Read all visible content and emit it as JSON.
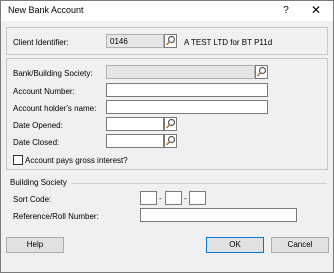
{
  "window": {
    "title": "New Bank Account",
    "help_glyph": "?",
    "close_glyph": "✕"
  },
  "client": {
    "label": "Client Identifier:",
    "value": "0146",
    "name": "A TEST LTD for BT P11d"
  },
  "fields": {
    "bank_label": "Bank/Building Society:",
    "bank_value": "",
    "account_number_label": "Account Number:",
    "account_number_value": "",
    "holder_label": "Account holder's name:",
    "holder_value": "",
    "opened_label": "Date Opened:",
    "opened_value": "",
    "closed_label": "Date Closed:",
    "closed_value": "",
    "gross_label": "Account pays gross interest?",
    "gross_checked": false
  },
  "building_society": {
    "title": "Building Society",
    "sort_code_label": "Sort Code:",
    "sort_code": [
      "",
      "",
      ""
    ],
    "sort_sep": "-",
    "roll_label": "Reference/Roll Number:",
    "roll_value": ""
  },
  "buttons": {
    "help": "Help",
    "ok": "OK",
    "cancel": "Cancel"
  }
}
